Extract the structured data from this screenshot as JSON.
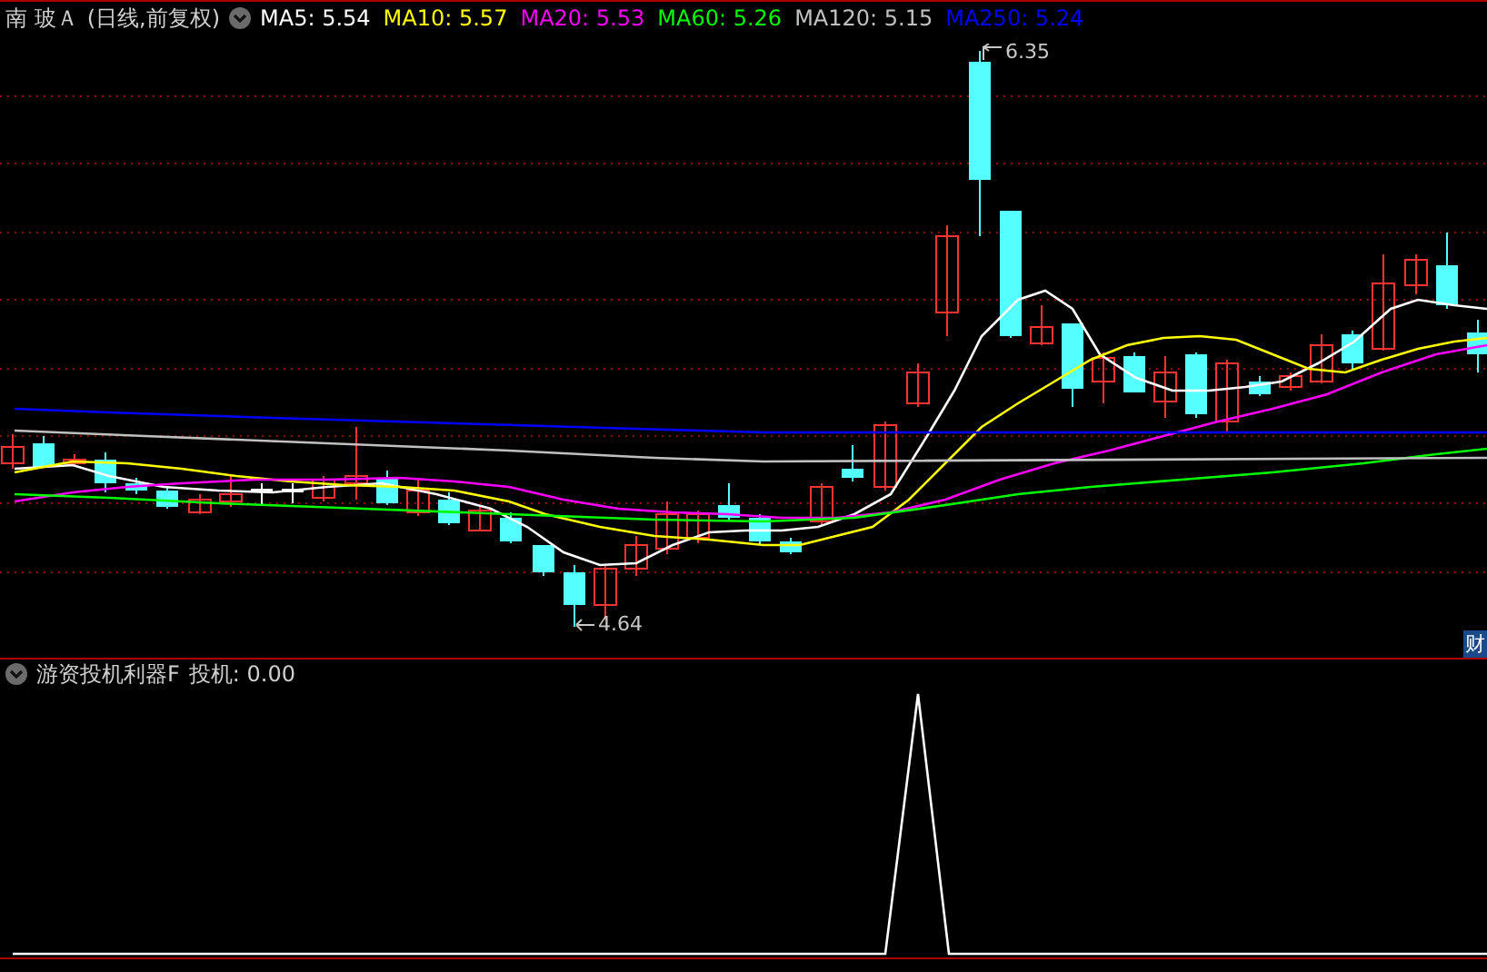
{
  "stock": {
    "name": "南 玻Ａ",
    "period": "(日线,前复权)"
  },
  "moving_averages": [
    {
      "label": "MA5: 5.54",
      "color": "#ffffff"
    },
    {
      "label": "MA10: 5.57",
      "color": "#ffff00"
    },
    {
      "label": "MA20: 5.53",
      "color": "#ff00ff"
    },
    {
      "label": "MA60: 5.26",
      "color": "#00ff00"
    },
    {
      "label": "MA120: 5.15",
      "color": "#c0c0c0"
    },
    {
      "label": "MA250: 5.24",
      "color": "#0000ff"
    }
  ],
  "price_labels": {
    "high": "6.35",
    "low": "4.64"
  },
  "badge": "财",
  "indicator": {
    "name": "游资投机利器F",
    "value": "投机: 0.00"
  }
}
